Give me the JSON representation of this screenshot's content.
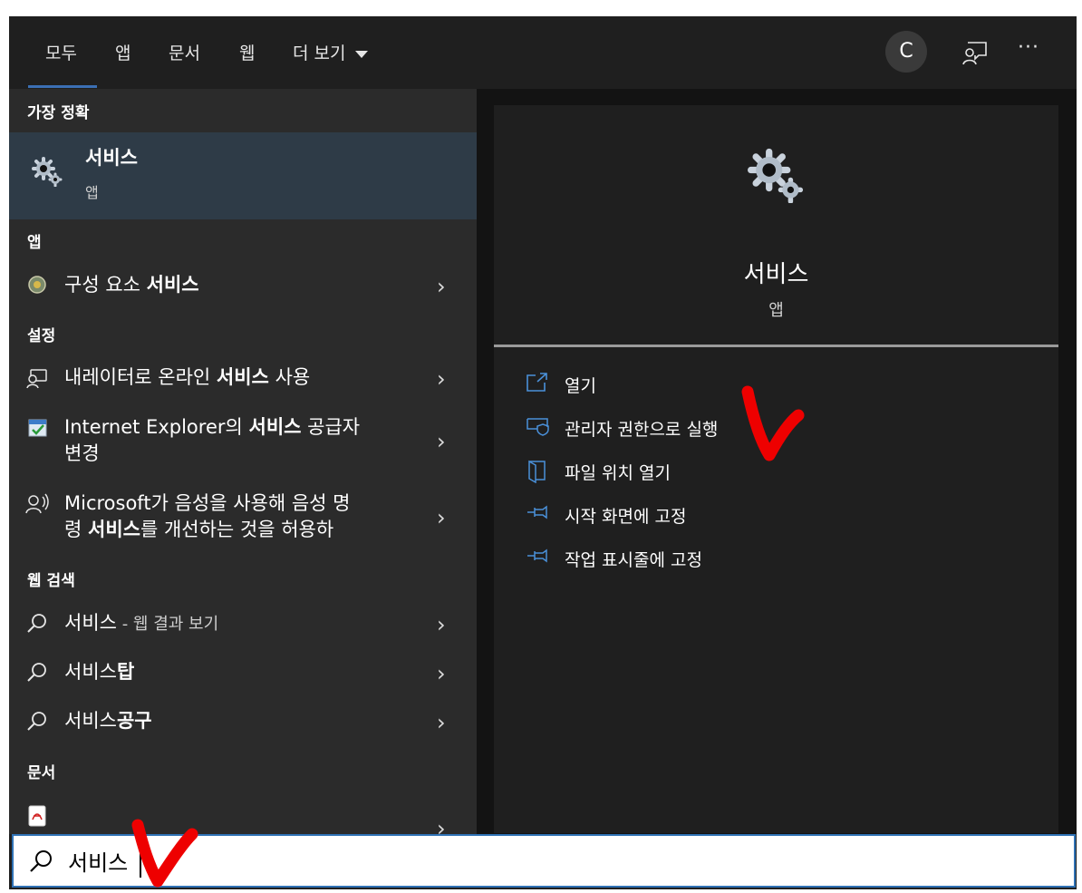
{
  "tabs": [
    {
      "label": "모두"
    },
    {
      "label": "앱"
    },
    {
      "label": "문서"
    },
    {
      "label": "웹"
    },
    {
      "label": "더 보기"
    }
  ],
  "header": {
    "avatar_initial": "C",
    "more_label": "···"
  },
  "left": {
    "best_match_title": "가장 정확",
    "best_match": {
      "name": "서비스",
      "type": "앱"
    },
    "apps_title": "앱",
    "apps": [
      {
        "prefix": "구성 요소 ",
        "highlight": "서비스"
      }
    ],
    "settings_title": "설정",
    "settings": [
      {
        "prefix": "내레이터로 온라인 ",
        "highlight": "서비스",
        "suffix": " 사용"
      },
      {
        "line1_prefix": "Internet Explorer의 ",
        "highlight": "서비스",
        "line1_suffix": " 공급자",
        "line2": "변경"
      },
      {
        "line1": "Microsoft가 음성을 사용해 음성 명",
        "line2_prefix": "령 ",
        "highlight": "서비스",
        "line2_suffix": "를 개선하는 것을 허용하"
      }
    ],
    "web_title": "웹 검색",
    "web": [
      {
        "highlight": "서비스",
        "suffix": " - 웹 결과 보기"
      },
      {
        "prefix": "서비스",
        "highlight": "탑"
      },
      {
        "prefix": "서비스",
        "highlight": "공구"
      }
    ],
    "docs_title": "문서"
  },
  "preview": {
    "title": "서비스",
    "subtitle": "앱",
    "actions": [
      {
        "label": "열기",
        "icon": "open-icon"
      },
      {
        "label": "관리자 권한으로 실행",
        "icon": "shield-icon"
      },
      {
        "label": "파일 위치 열기",
        "icon": "file-location-icon"
      },
      {
        "label": "시작 화면에 고정",
        "icon": "pin-icon"
      },
      {
        "label": "작업 표시줄에 고정",
        "icon": "pin-icon"
      }
    ]
  },
  "search": {
    "value": "서비스"
  },
  "colors": {
    "accent": "#3b6fb4",
    "action_icon": "#4a90d9",
    "annotation": "#ee0000",
    "selected_row": "#2e3b47"
  }
}
